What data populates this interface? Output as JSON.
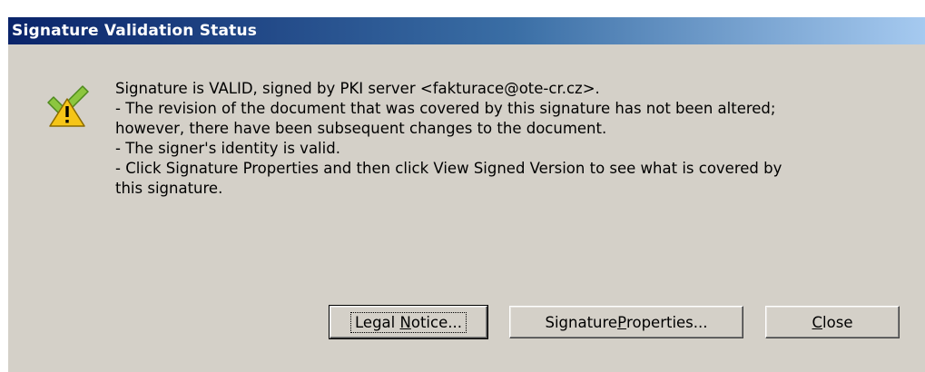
{
  "dialog": {
    "title": "Signature Validation Status",
    "icon": "valid-with-warning-icon",
    "message_lines": [
      "Signature is VALID, signed by PKI server <fakturace@ote-cr.cz>.",
      "- The revision of the document that was covered by this signature has not been altered;",
      "however, there have been subsequent changes to the document.",
      "- The signer's identity is valid.",
      "- Click Signature Properties and then click View Signed Version to see what is covered by",
      "this signature."
    ]
  },
  "buttons": {
    "legal_notice": {
      "pre": "Legal ",
      "mnemonic": "N",
      "post": "otice..."
    },
    "signature_properties": {
      "pre": "Signature ",
      "mnemonic": "P",
      "post": "roperties..."
    },
    "close": {
      "pre": "",
      "mnemonic": "C",
      "post": "lose"
    }
  },
  "colors": {
    "title_gradient_start": "#0a246a",
    "title_gradient_end": "#a6caf0",
    "dialog_background": "#d4d0c8",
    "check_green": "#7ac143",
    "warning_yellow": "#f5c518"
  }
}
